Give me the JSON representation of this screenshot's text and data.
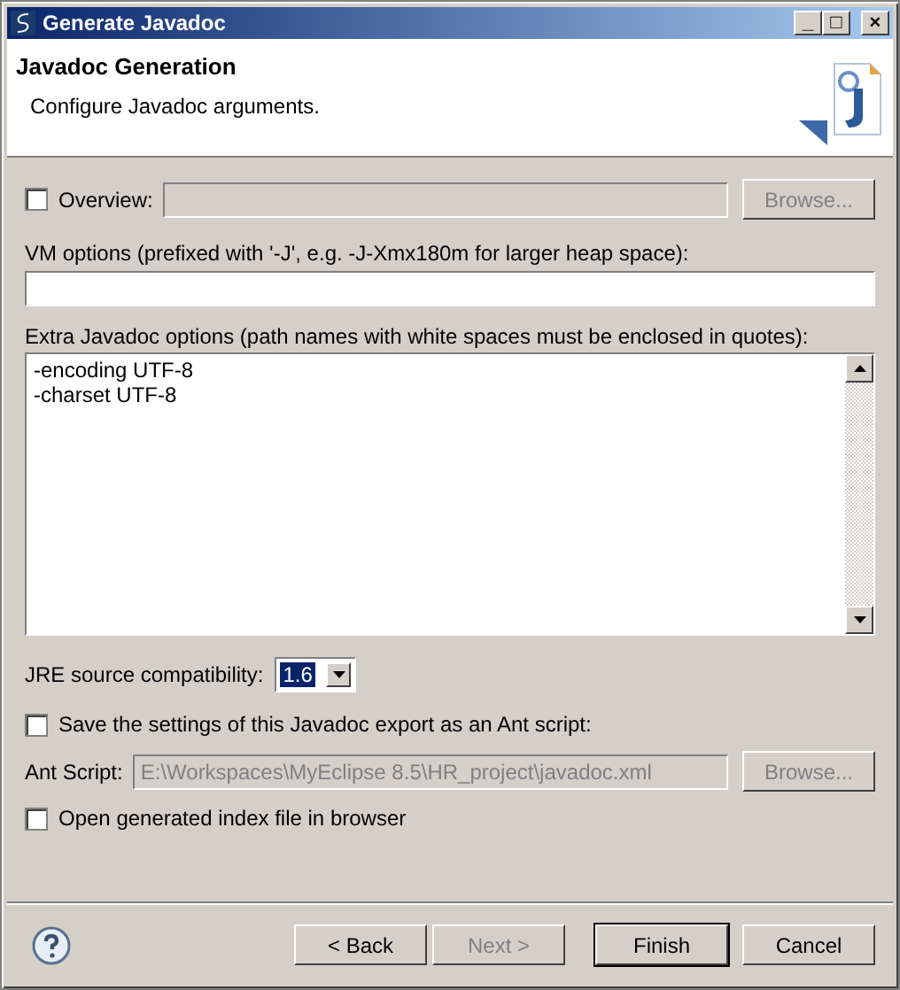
{
  "window": {
    "title": "Generate Javadoc",
    "controls": [
      "_",
      "□",
      "×"
    ]
  },
  "header": {
    "title": "Javadoc Generation",
    "description": "Configure Javadoc arguments."
  },
  "overview": {
    "label": "Overview:",
    "checked": false,
    "value_disabled": true,
    "browse": {
      "label": "Browse...",
      "disabled": true
    }
  },
  "vm_options": {
    "label": "VM options (prefixed with '-J', e.g. -J-Xmx180m for larger heap space):"
  },
  "extra_options": {
    "label": "Extra Javadoc options (path names with white spaces must be enclosed in quotes):",
    "lines": [
      "-encoding UTF-8",
      "-charset UTF-8"
    ]
  },
  "jre": {
    "label": "JRE source compatibility:",
    "value": "1.6"
  },
  "save_ant": {
    "label": "Save the settings of this Javadoc export as an Ant script:",
    "checked": false
  },
  "ant_script": {
    "label": "Ant Script:",
    "value": "E:\\Workspaces\\MyEclipse 8.5\\HR_project\\javadoc.xml",
    "disabled": true,
    "browse": {
      "label": "Browse...",
      "disabled": true
    }
  },
  "open_index": {
    "label": "Open generated index file in browser",
    "checked": false
  },
  "buttons": [
    {
      "label": "< Back",
      "disabled": false,
      "default": false
    },
    {
      "label": "Next >",
      "disabled": true,
      "default": false
    },
    {
      "label": "Finish",
      "disabled": false,
      "default": true
    },
    {
      "label": "Cancel",
      "disabled": false,
      "default": false
    }
  ]
}
